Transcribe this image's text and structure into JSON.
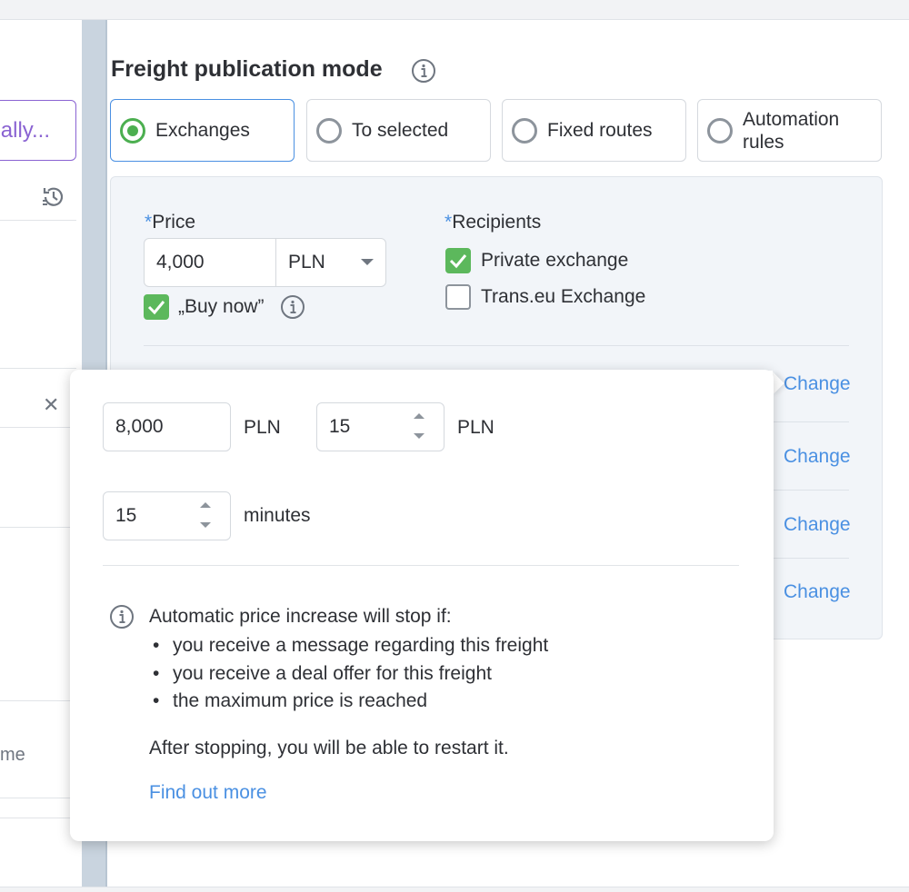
{
  "left_panel": {
    "partial_button_text": "ally...",
    "partial_text_bottom": "me"
  },
  "section": {
    "title": "Freight publication mode"
  },
  "modes": [
    {
      "label": "Exchanges",
      "selected": true
    },
    {
      "label": "To selected",
      "selected": false
    },
    {
      "label": "Fixed routes",
      "selected": false
    },
    {
      "label": "Automation rules",
      "selected": false
    }
  ],
  "price": {
    "required_mark": "*",
    "label": "Price",
    "value": "4,000",
    "currency": "PLN",
    "buy_now_label": "„Buy now”",
    "buy_now_checked": true
  },
  "recipients": {
    "required_mark": "*",
    "label": "Recipients",
    "private_exchange_label": "Private exchange",
    "private_exchange_checked": true,
    "transeu_label": "Trans.eu Exchange",
    "transeu_checked": false
  },
  "change_links": [
    "Change",
    "Change",
    "Change",
    "Change"
  ],
  "popover": {
    "max_price_value": "8,000",
    "max_price_unit": "PLN",
    "step_value": "15",
    "step_unit": "PLN",
    "interval_value": "15",
    "interval_unit": "minutes",
    "info_heading": "Automatic price increase will stop if:",
    "conditions": [
      "you receive a message regarding this freight",
      "you receive a deal offer for this freight",
      "the maximum price is reached"
    ],
    "restart_note": "After stopping, you will be able to restart it.",
    "find_out_more": "Find out more"
  },
  "colors": {
    "accent_blue": "#4a90e2",
    "success_green": "#5cb85c",
    "purple_outline": "#8a63d2"
  }
}
